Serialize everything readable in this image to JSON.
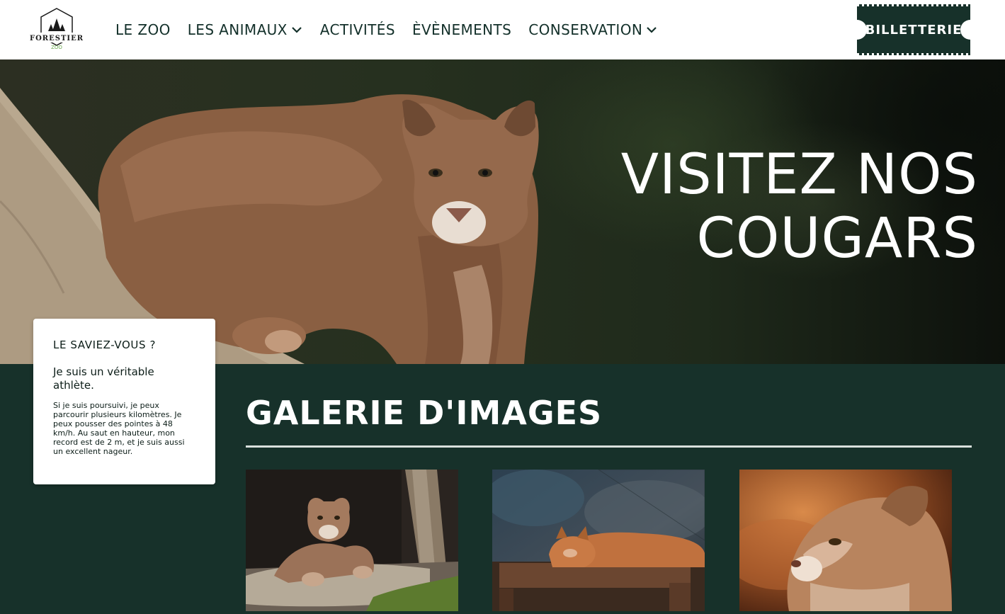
{
  "header": {
    "logo": {
      "brand_text": "FORESTIER",
      "sub_text": "ZOO"
    },
    "nav": [
      {
        "label": "LE ZOO",
        "has_dropdown": false
      },
      {
        "label": "LES ANIMAUX",
        "has_dropdown": true
      },
      {
        "label": "ACTIVITÉS",
        "has_dropdown": false
      },
      {
        "label": "ÈVÈNEMENTS",
        "has_dropdown": false
      },
      {
        "label": "CONSERVATION",
        "has_dropdown": true
      }
    ],
    "ticket_button": "BILLETTERIE"
  },
  "hero": {
    "title_line1": "VISITEZ NOS",
    "title_line2": "COUGARS"
  },
  "fact_card": {
    "title": "LE SAVIEZ-VOUS ?",
    "headline": "Je suis un véritable athlète.",
    "body": "Si je suis poursuivi, je peux parcourir plusieurs kilomètres. Je peux pousser des pointes à 48 km/h. Au saut en hauteur, mon record est de 2 m, et je suis aussi un excellent nageur."
  },
  "gallery": {
    "title": "GALERIE D'IMAGES",
    "images": [
      {
        "subject": "cougar-lying-on-log"
      },
      {
        "subject": "cougar-sleeping-on-bench"
      },
      {
        "subject": "cougar-head-closeup"
      }
    ]
  },
  "colors": {
    "brand_dark_green": "#17312a",
    "header_bg": "#ffffff",
    "text_dark": "#13302a",
    "logo_accent_green": "#6aa84f"
  },
  "icons": {
    "dropdown": "chevron-down-icon",
    "logo": "forestier-zoo-logo"
  }
}
